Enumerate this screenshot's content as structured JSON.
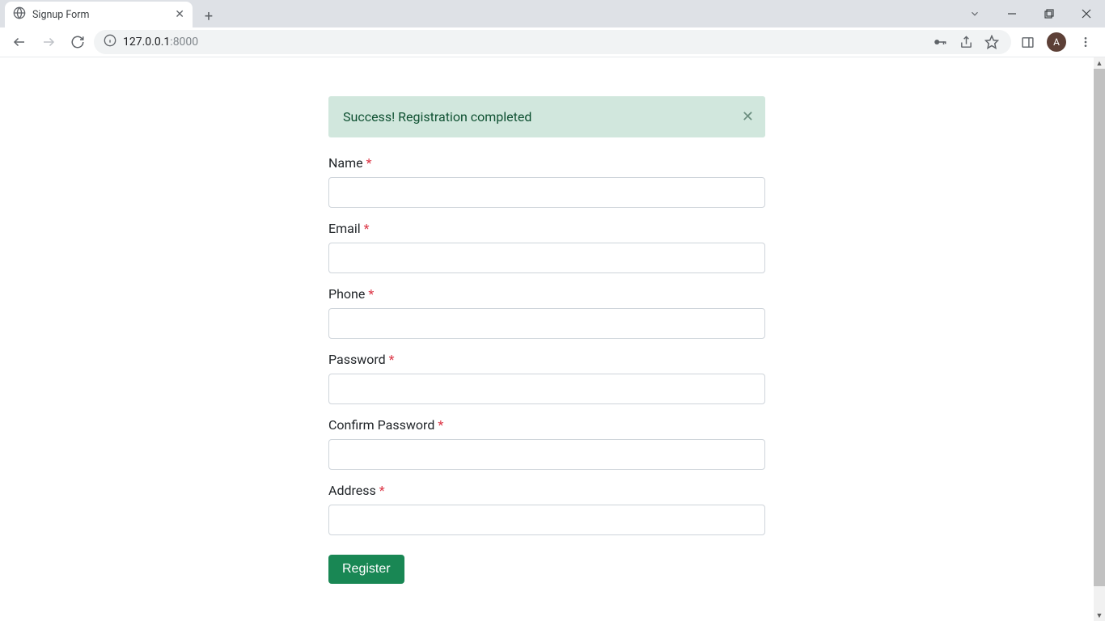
{
  "tab": {
    "title": "Signup Form"
  },
  "address": {
    "host": "127.0.0.1",
    "port": ":8000"
  },
  "avatar": {
    "initial": "A"
  },
  "alert": {
    "text": "Success! Registration completed"
  },
  "form": {
    "fields": [
      {
        "label": "Name",
        "name": "name-field"
      },
      {
        "label": "Email",
        "name": "email-field"
      },
      {
        "label": "Phone",
        "name": "phone-field"
      },
      {
        "label": "Password",
        "name": "password-field"
      },
      {
        "label": "Confirm Password",
        "name": "confirm-password-field"
      },
      {
        "label": "Address",
        "name": "address-field"
      }
    ],
    "submit_label": "Register",
    "required_marker": "*"
  }
}
